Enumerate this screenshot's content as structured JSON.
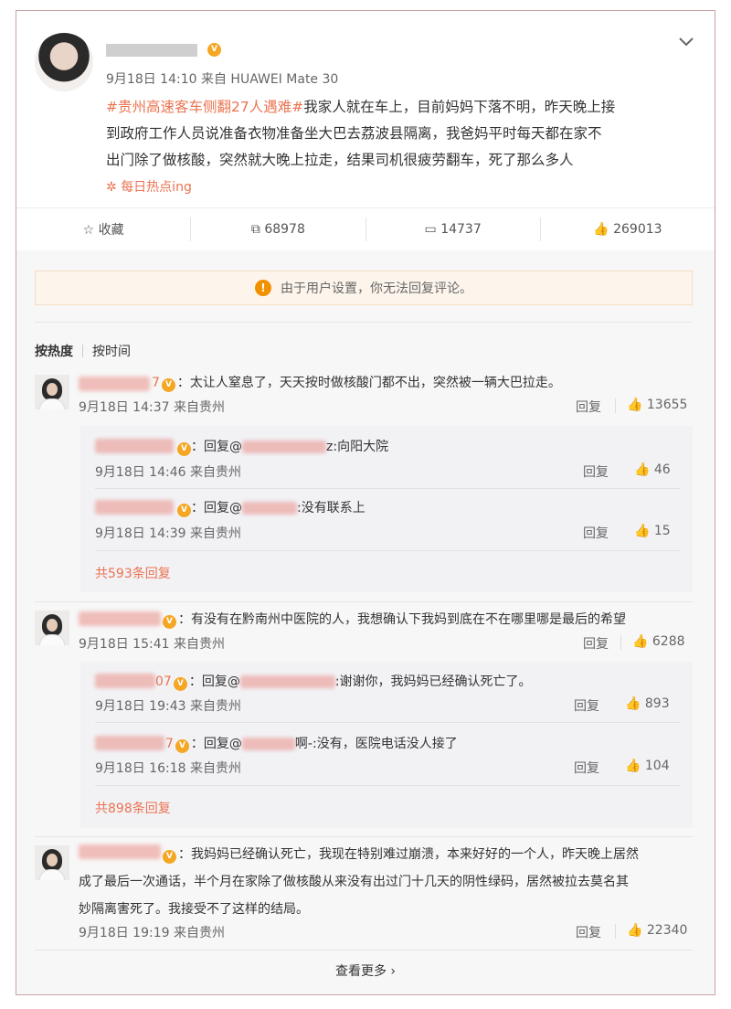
{
  "post": {
    "time": "9月18日 14:10",
    "source": "来自 HUAWEI Mate 30",
    "hashtag": "#贵州高速客车侧翻27人遇难#",
    "body_lines": [
      "我家人就在车上，目前妈妈下落不明，昨天晚上接",
      "到政府工作人员说准备衣物准备坐大巴去荔波县隔离，我爸妈平时每天都在家不",
      "出门除了做核酸，突然就大晚上拉走，结果司机很疲劳翻车，死了那么多人"
    ],
    "topic_tag": "每日热点ing"
  },
  "actions": {
    "favorite": "收藏",
    "repost": "68978",
    "comment": "14737",
    "like": "269013"
  },
  "notice": "由于用户设置，你无法回复评论。",
  "sort": {
    "hot": "按热度",
    "time": "按时间"
  },
  "comments": [
    {
      "name_tail": "7",
      "text": "：太让人窒息了，天天按时做核酸门都不出，突然被一辆大巴拉走。",
      "time": "9月18日 14:37 来自贵州",
      "reply": "回复",
      "likes": "13655",
      "replies": [
        {
          "name_tail": "",
          "text": "：回复@",
          "target_tail": "z:向阳大院",
          "time": "9月18日 14:46 来自贵州",
          "reply": "回复",
          "likes": "46"
        },
        {
          "name_tail": "",
          "text": "：回复@",
          "target_tail": ":没有联系上",
          "time": "9月18日 14:39 来自贵州",
          "reply": "回复",
          "likes": "15"
        }
      ],
      "more": "共593条回复"
    },
    {
      "name_tail": "",
      "text": "：有没有在黔南州中医院的人，我想确认下我妈到底在不在哪里哪是最后的希望",
      "time": "9月18日 15:41 来自贵州",
      "reply": "回复",
      "likes": "6288",
      "replies": [
        {
          "name_tail": "07",
          "text": "：回复@",
          "target_tail": ":谢谢你，我妈妈已经确认死亡了。",
          "time": "9月18日 19:43 来自贵州",
          "reply": "回复",
          "likes": "893"
        },
        {
          "name_tail": "7",
          "text": "：回复@",
          "target_tail": "啊-:没有，医院电话没人接了",
          "time": "9月18日 16:18 来自贵州",
          "reply": "回复",
          "likes": "104"
        }
      ],
      "more": "共898条回复"
    },
    {
      "name_tail": "",
      "text_lines": [
        "：我妈妈已经确认死亡，我现在特别难过崩溃，本来好好的一个人，昨天晚上居然",
        "成了最后一次通话，半个月在家除了做核酸从来没有出过门十几天的阴性绿码，居然被拉去莫名其",
        "妙隔离害死了。我接受不了这样的结局。"
      ],
      "time": "9月18日 19:19 来自贵州",
      "reply": "回复",
      "likes": "22340"
    }
  ],
  "see_more": "查看更多",
  "colors": {
    "accent": "#eb7350",
    "link": "#eb7350",
    "notice_bg": "#fdf5ec"
  }
}
